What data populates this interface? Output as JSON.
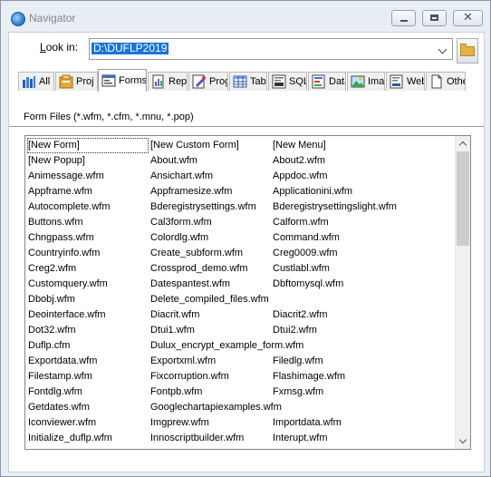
{
  "window": {
    "title": "Navigator",
    "close_glyph": "✕"
  },
  "lookin": {
    "label_prefix": "L",
    "label_rest": "ook in:",
    "value": "D:\\DUFLP2019"
  },
  "tabs": [
    {
      "label": "All",
      "icon": "all-icon"
    },
    {
      "label": "Proj",
      "icon": "project-icon"
    },
    {
      "label": "Forms",
      "icon": "forms-icon"
    },
    {
      "label": "Reports",
      "icon": "reports-icon"
    },
    {
      "label": "Programs",
      "icon": "programs-icon"
    },
    {
      "label": "Tables",
      "icon": "tables-icon"
    },
    {
      "label": "SQL",
      "icon": "sql-icon"
    },
    {
      "label": "Datamodules",
      "icon": "datamodules-icon"
    },
    {
      "label": "Images",
      "icon": "images-icon"
    },
    {
      "label": "Web",
      "icon": "web-icon"
    },
    {
      "label": "Other",
      "icon": "other-icon"
    }
  ],
  "filter_label": "Form Files (*.wfm, *.cfm, *.mnu, *.pop)",
  "file_list": {
    "col1": [
      "[New Form]",
      "[New Popup]",
      "Animessage.wfm",
      "Appframe.wfm",
      "Autocomplete.wfm",
      "Buttons.wfm",
      "Chngpass.wfm",
      "Countryinfo.wfm",
      "Creg2.wfm",
      "Customquery.wfm",
      "Dbobj.wfm",
      "Deointerface.wfm",
      "Dot32.wfm",
      "Duflp.cfm",
      "Exportdata.wfm",
      "Filestamp.wfm",
      "Fontdlg.wfm",
      "Getdates.wfm",
      "Iconviewer.wfm",
      "Initialize_duflp.wfm"
    ],
    "col2": [
      "[New Custom Form]",
      "About.wfm",
      "Ansichart.wfm",
      "Appframesize.wfm",
      "Bderegistrysettings.wfm",
      "Cal3form.wfm",
      "Colordlg.wfm",
      "Create_subform.wfm",
      "Crossprod_demo.wfm",
      "Datespantest.wfm",
      "Delete_compiled_files.wfm",
      "Diacrit.wfm",
      "Dtui1.wfm",
      "Dulux_encrypt_example_form.wfm",
      "Exportxml.wfm",
      "Fixcorruption.wfm",
      "Fontpb.wfm",
      "Googlechartapiexamples.wfm",
      "Imgprew.wfm",
      "Innoscriptbuilder.wfm"
    ],
    "col3": [
      "[New Menu]",
      "About2.wfm",
      "Appdoc.wfm",
      "Applicationini.wfm",
      "Bderegistrysettingslight.wfm",
      "Calform.wfm",
      "Command.wfm",
      "Creg0009.wfm",
      "Custlabl.wfm",
      "Dbftomysql.wfm",
      "",
      "Diacrit2.wfm",
      "Dtui2.wfm",
      "",
      "Filedlg.wfm",
      "Flashimage.wfm",
      "Fxmsg.wfm",
      "",
      "Importdata.wfm",
      "Interupt.wfm"
    ]
  }
}
